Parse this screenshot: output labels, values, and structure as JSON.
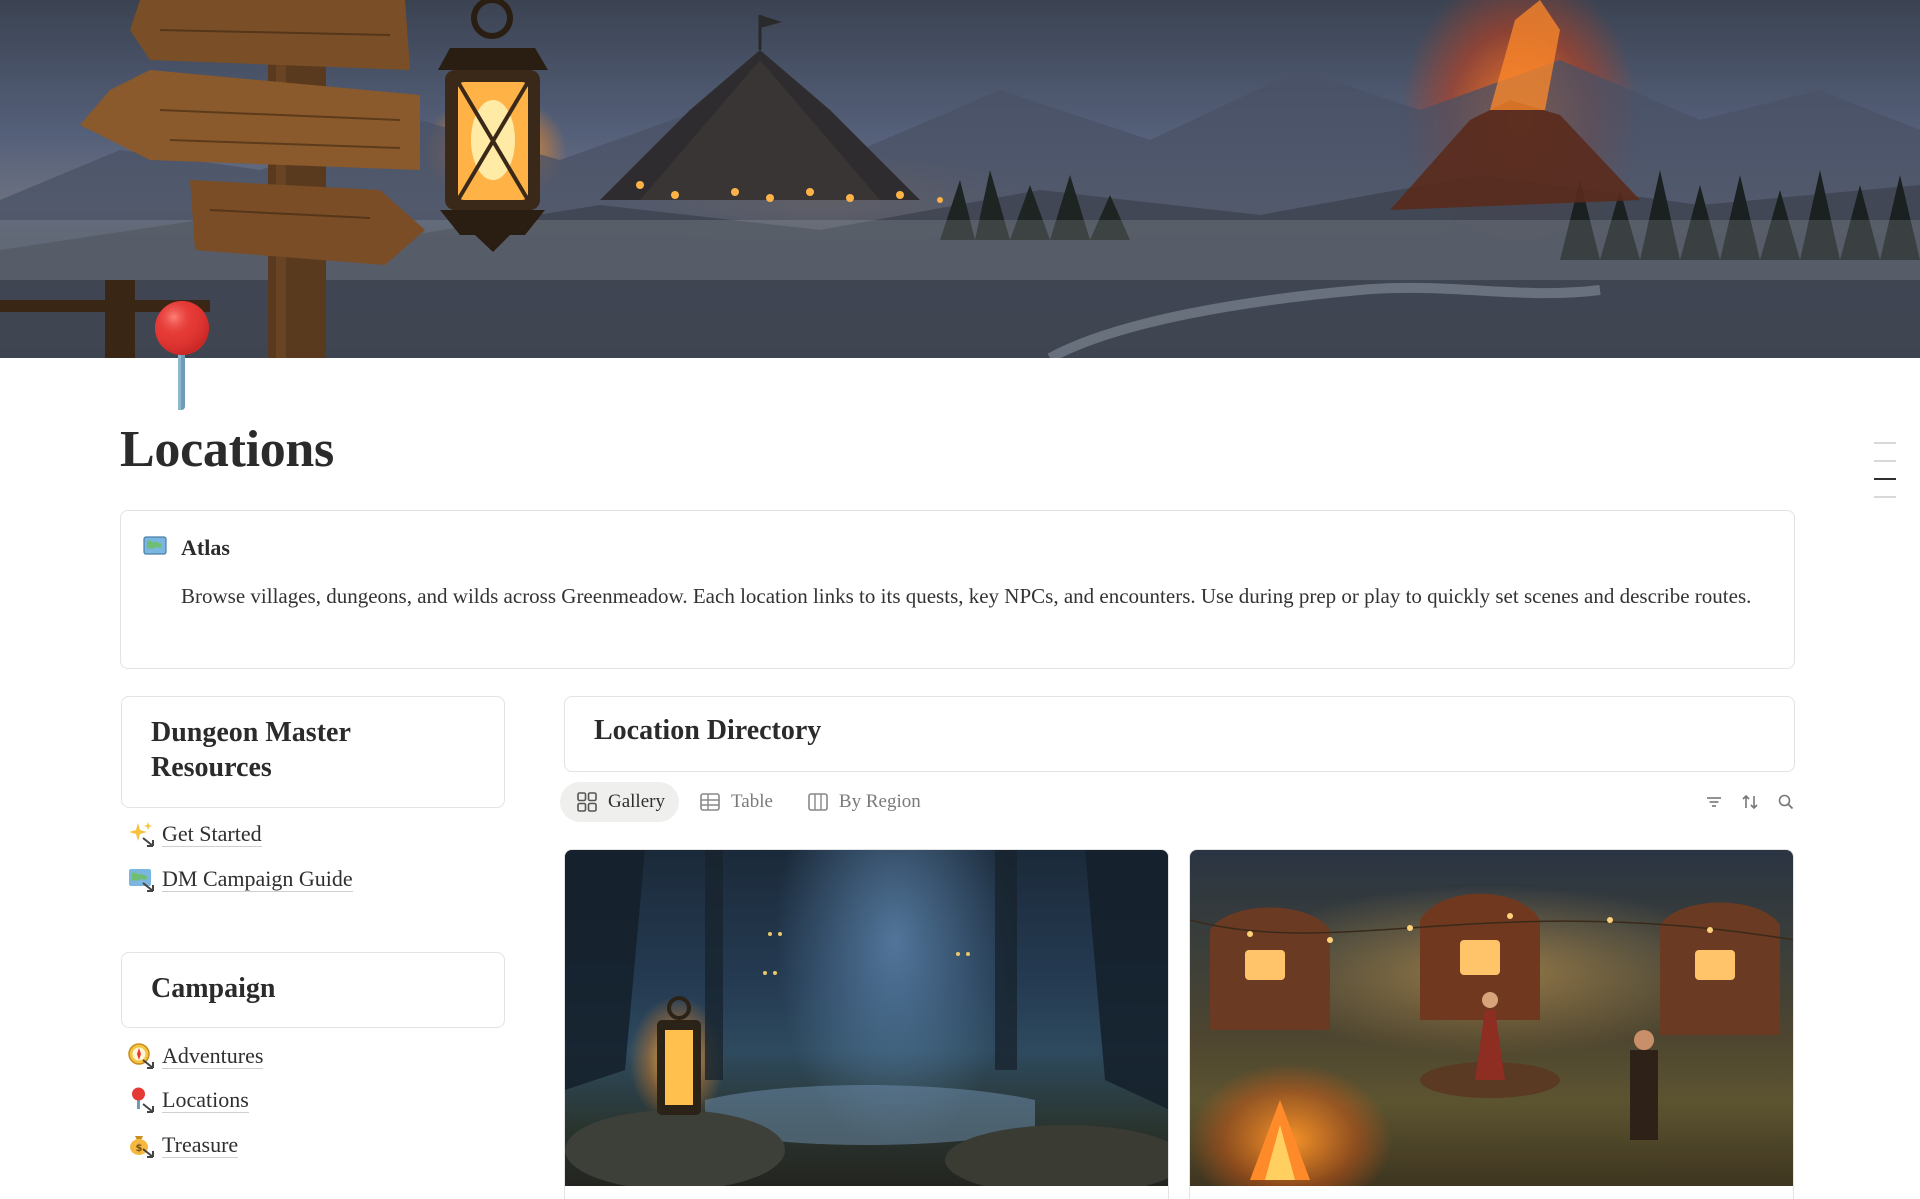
{
  "page": {
    "title": "Locations",
    "cover_icon": "signpost-lantern-landscape-image",
    "page_icon": "round-pushpin-icon"
  },
  "callout": {
    "icon": "world-map-icon",
    "title": "Atlas",
    "body": "Browse villages, dungeons, and wilds across Greenmeadow. Each location links to its quests, key NPCs, and encounters. Use during prep or play to quickly set scenes and describe routes."
  },
  "sidebar": {
    "dm_heading": "Dungeon Master Resources",
    "dm_links": [
      {
        "label": "Get Started",
        "icon": "sparkles-icon"
      },
      {
        "label": "DM Campaign Guide",
        "icon": "world-map-icon"
      }
    ],
    "campaign_heading": "Campaign",
    "campaign_links": [
      {
        "label": "Adventures",
        "icon": "compass-icon"
      },
      {
        "label": "Locations",
        "icon": "round-pushpin-icon"
      },
      {
        "label": "Treasure",
        "icon": "money-bag-icon"
      }
    ]
  },
  "directory": {
    "heading": "Location Directory",
    "views": [
      {
        "label": "Gallery",
        "icon": "gallery-grid-icon",
        "active": true
      },
      {
        "label": "Table",
        "icon": "table-icon",
        "active": false
      },
      {
        "label": "By Region",
        "icon": "board-columns-icon",
        "active": false
      }
    ],
    "tools": [
      "filter-icon",
      "sort-icon",
      "search-icon"
    ],
    "cards": [
      {
        "image": "lantern-swamp-forest-image"
      },
      {
        "image": "caravan-camp-festival-image"
      }
    ]
  },
  "colors": {
    "border": "#e3e3e3",
    "text": "#2f2f2f",
    "muted": "#7a7a7a",
    "active_tab_bg": "#efefee",
    "pin_red": "#e53935"
  }
}
